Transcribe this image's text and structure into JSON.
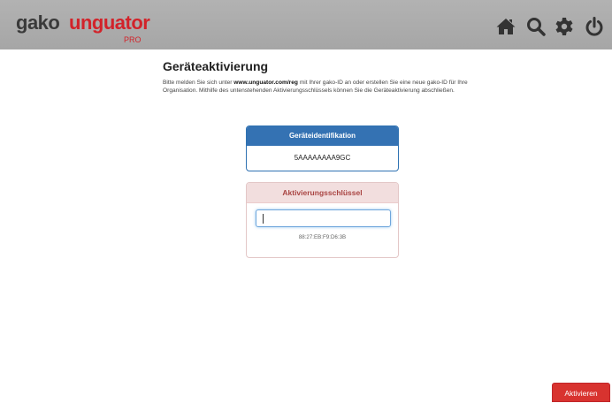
{
  "header": {
    "logo": {
      "part1": "gako",
      "part2": "unguator",
      "badge": "PRO"
    },
    "icons": [
      "home-icon",
      "search-icon",
      "gear-icon",
      "power-icon"
    ]
  },
  "main": {
    "title": "Geräteaktivierung",
    "description_pre": "Bitte melden Sie sich unter ",
    "description_link": "www.unguator.com/reg",
    "description_post": " mit Ihrer gako-ID an oder erstellen Sie eine neue gako-ID für Ihre Organisation. Mithilfe des untenstehenden Aktivierungsschlüssels können Sie die Geräteaktivierung abschließen."
  },
  "device_card": {
    "header": "Geräteidentifikation",
    "value": "5AAAAAAAA9GC"
  },
  "key_card": {
    "header": "Aktivierungsschlüssel",
    "input_value": "",
    "mac": "88:27:EB:F9:D6:3B"
  },
  "footer": {
    "activate_label": "Aktivieren"
  },
  "colors": {
    "brand_red": "#d2232a",
    "header_gray": "#aaaaaa",
    "primary_blue": "#3472b3",
    "danger_bg": "#f2dede"
  }
}
